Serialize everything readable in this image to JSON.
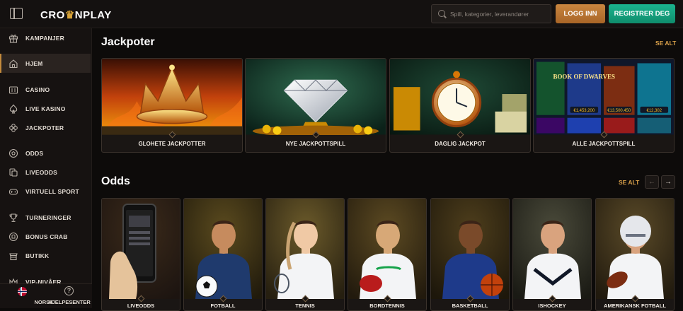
{
  "header": {
    "logo_text_before": "CRO",
    "logo_crown": "♛",
    "logo_text_after": "NPLAY",
    "search_placeholder": "Spill, kategorier, leverandører",
    "login_label": "LOGG INN",
    "register_label": "REGISTRER DEG"
  },
  "sidebar": {
    "items": [
      {
        "label": "KAMPANJER",
        "icon": "gift-icon"
      },
      {
        "label": "HJEM",
        "icon": "home-icon",
        "active": true
      },
      {
        "label": "CASINO",
        "icon": "slot-machine-icon"
      },
      {
        "label": "LIVE KASINO",
        "icon": "spade-icon"
      },
      {
        "label": "JACKPOTER",
        "icon": "clover-icon"
      },
      {
        "label": "ODDS",
        "icon": "ball-icon"
      },
      {
        "label": "LIVEODDS",
        "icon": "live-odds-icon"
      },
      {
        "label": "VIRTUELL SPORT",
        "icon": "gamepad-icon"
      },
      {
        "label": "TURNERINGER",
        "icon": "trophy-icon"
      },
      {
        "label": "BONUS CRAB",
        "icon": "crab-icon"
      },
      {
        "label": "BUTIKK",
        "icon": "shop-icon"
      },
      {
        "label": "VIP-NIVÅER",
        "icon": "crown-icon"
      }
    ],
    "footer": {
      "language": "NORSK",
      "help": "HJELPESENTER",
      "help_glyph": "?"
    }
  },
  "jackpots": {
    "title": "Jackpoter",
    "see_all": "SE ALT",
    "cards": [
      {
        "label": "GLOHETE JACKPOTTER"
      },
      {
        "label": "NYE JACKPOTTSPILL"
      },
      {
        "label": "DAGLIG JACKPOT"
      },
      {
        "label": "ALLE JACKPOTTSPILL"
      }
    ],
    "game_tiles": [
      "BOOK OF DWARVES"
    ],
    "tile_amounts": [
      "€1,453,200",
      "€13,500,450",
      "€12,302"
    ]
  },
  "odds": {
    "title": "Odds",
    "see_all": "SE ALT",
    "prev_glyph": "←",
    "next_glyph": "→",
    "cards": [
      {
        "label": "LIVEODDS"
      },
      {
        "label": "FOTBALL"
      },
      {
        "label": "TENNIS"
      },
      {
        "label": "BORDTENNIS"
      },
      {
        "label": "BASKETBALL"
      },
      {
        "label": "ISHOCKEY"
      },
      {
        "label": "AMERIKANSK FOTBALL"
      }
    ]
  },
  "colors": {
    "accent_gold": "#d9a04a",
    "login_orange": "#b8763a",
    "register_green": "#16a47f",
    "background": "#0d0b0a"
  }
}
